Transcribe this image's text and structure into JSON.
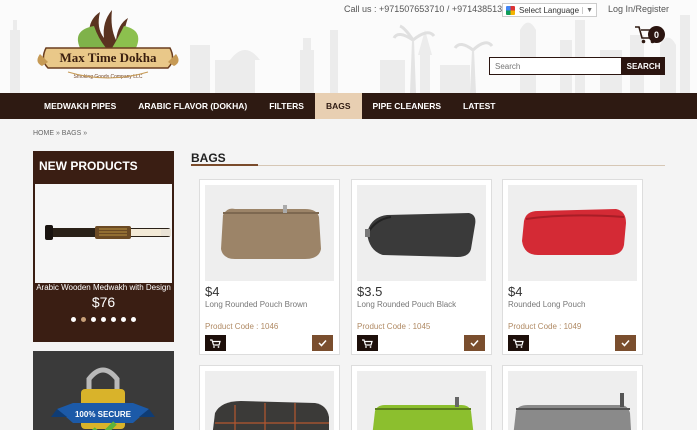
{
  "header": {
    "logo": {
      "brand": "Max Time Dokha",
      "tagline": "Smoking Goods Company LLC"
    },
    "call_us": "Call us : +971507653710 / +97143851314",
    "language_label": "Select Language",
    "login_label": "Log In/Register",
    "cart_count": "0",
    "search_placeholder": "Search",
    "search_button": "SEARCH"
  },
  "nav": {
    "items": [
      {
        "label": "MEDWAKH PIPES"
      },
      {
        "label": "ARABIC FLAVOR (DOKHA)"
      },
      {
        "label": "FILTERS"
      },
      {
        "label": "BAGS"
      },
      {
        "label": "PIPE CLEANERS"
      },
      {
        "label": "LATEST"
      }
    ],
    "active": "BAGS"
  },
  "breadcrumb": {
    "home": "HOME »",
    "current": "BAGS »"
  },
  "sidebar": {
    "new_products_title": "NEW PRODUCTS",
    "featured": {
      "name": "Arabic Wooden Medwakh with Design",
      "price": "$76"
    },
    "carousel_dots": 7,
    "carousel_active_index": 1,
    "secure_badge": "100% SECURE"
  },
  "section": {
    "title": "BAGS"
  },
  "products": [
    {
      "price": "$4",
      "name": "Long Rounded Pouch Brown",
      "code": "Product Code : 1046",
      "color": "#9c8468"
    },
    {
      "price": "$3.5",
      "name": "Long Rounded Pouch Black",
      "code": "Product Code : 1045",
      "color": "#3a3a3a"
    },
    {
      "price": "$4",
      "name": "Rounded Long Pouch",
      "code": "Product Code : 1049",
      "color": "#d42a35"
    }
  ],
  "products_row2": [
    {
      "color": "#3b3a38"
    },
    {
      "color": "#8cbf2e"
    },
    {
      "color": "#8a8a8a"
    }
  ],
  "colors": {
    "brand_dark": "#2e1a12",
    "nav_active": "#e8cfb2",
    "accent_brown": "#7a4e2e"
  }
}
